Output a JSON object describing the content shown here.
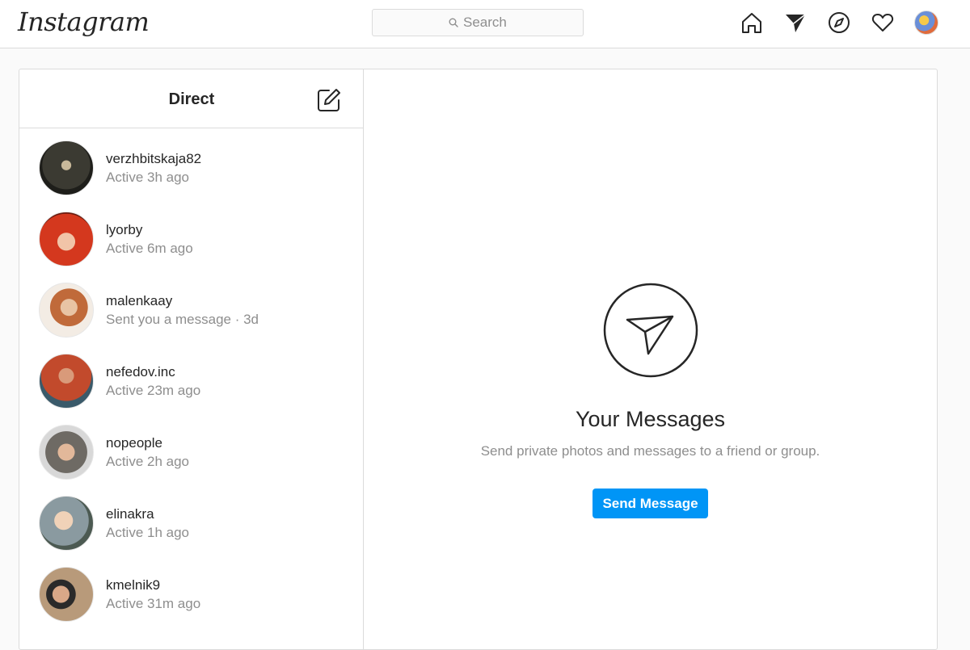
{
  "header": {
    "logo": "Instagram",
    "search_placeholder": "Search",
    "icons": [
      "home-icon",
      "direct-icon",
      "explore-icon",
      "activity-heart-icon",
      "profile-avatar"
    ]
  },
  "direct": {
    "title": "Direct",
    "compose_icon": "new-message-icon",
    "conversations": [
      {
        "username": "verzhbitskaja82",
        "status": "Active 3h ago"
      },
      {
        "username": "lyorby",
        "status": "Active 6m ago"
      },
      {
        "username": "malenkaay",
        "status": "Sent you a message · 3d"
      },
      {
        "username": "nefedov.inc",
        "status": "Active 23m ago"
      },
      {
        "username": "nopeople",
        "status": "Active 2h ago"
      },
      {
        "username": "elinakra",
        "status": "Active 1h ago"
      },
      {
        "username": "kmelnik9",
        "status": "Active 31m ago"
      }
    ]
  },
  "empty_state": {
    "title": "Your Messages",
    "subtitle": "Send private photos and messages to a friend or group.",
    "button": "Send Message"
  },
  "colors": {
    "accent": "#0095f6",
    "text": "#262626",
    "secondary_text": "#8e8e8e",
    "border": "#dbdbdb",
    "background": "#fafafa"
  }
}
